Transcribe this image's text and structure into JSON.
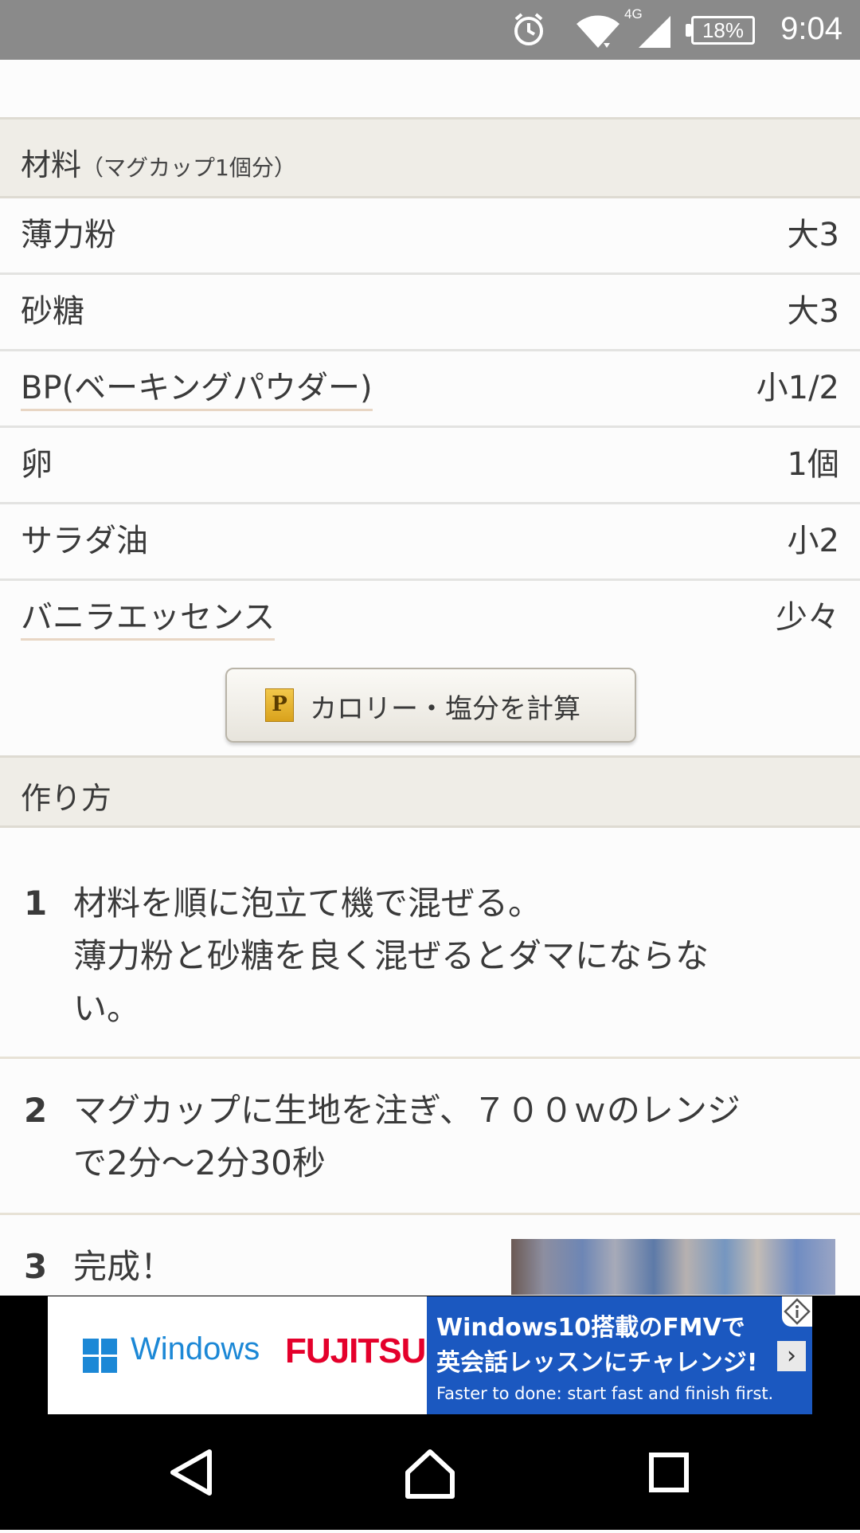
{
  "status_bar": {
    "time": "9:04",
    "battery": "18%",
    "network": "4G",
    "icons": [
      "alarm-icon",
      "wifi-icon",
      "cell-signal-icon",
      "battery-icon"
    ]
  },
  "ingredients": {
    "title": "材料",
    "serving": "（マグカップ1個分）",
    "items": [
      {
        "name": "薄力粉",
        "qty": "大3",
        "link": false
      },
      {
        "name": "砂糖",
        "qty": "大3",
        "link": false
      },
      {
        "name": "BP(ベーキングパウダー)",
        "qty": "小1/2",
        "link": true
      },
      {
        "name": "卵",
        "qty": "1個",
        "link": false
      },
      {
        "name": "サラダ油",
        "qty": "小2",
        "link": false
      },
      {
        "name": "バニラエッセンス",
        "qty": "少々",
        "link": true
      }
    ],
    "calc_button": {
      "icon_letter": "P",
      "label": "カロリー・塩分を計算"
    }
  },
  "directions": {
    "title": "作り方",
    "steps": [
      {
        "num": "1",
        "lines": [
          "材料を順に泡立て機で混ぜる。",
          "薄力粉と砂糖を良く混ぜるとダマにならな",
          "い。"
        ]
      },
      {
        "num": "2",
        "lines": [
          "マグカップに生地を注ぎ、７００ｗのレンジ",
          "で2分〜2分30秒"
        ]
      },
      {
        "num": "3",
        "lines": [
          "完成！"
        ]
      }
    ]
  },
  "ad": {
    "windows_label": "Windows",
    "brand": "FUJITSU",
    "line1": "Windows10搭載のFMVで",
    "line2": "英会話レッスンにチャレンジ!",
    "line3": "Faster to done: start fast and finish first.",
    "arrow": "›"
  },
  "colors": {
    "status_bar": "#8a8a8a",
    "section_header": "#efede7",
    "ad_blue": "#1b58c0",
    "windows_blue": "#1c88d6",
    "fujitsu_red": "#e4002b"
  }
}
